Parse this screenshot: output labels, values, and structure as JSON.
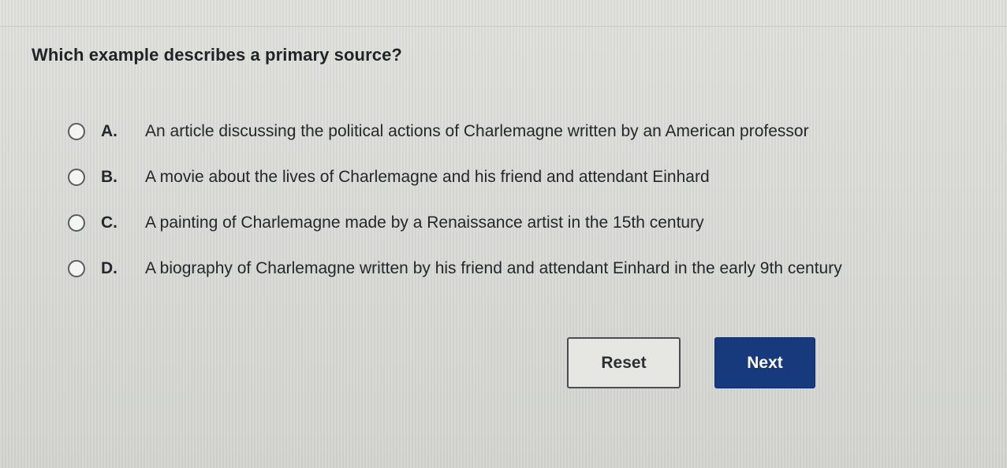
{
  "question": {
    "text": "Which example describes a primary source?"
  },
  "options": [
    {
      "letter": "A.",
      "text": "An article discussing the political actions of Charlemagne written by an American professor",
      "selected": false
    },
    {
      "letter": "B.",
      "text": "A movie about the lives of Charlemagne and his friend and attendant Einhard",
      "selected": false
    },
    {
      "letter": "C.",
      "text": "A painting of Charlemagne made by a Renaissance artist in the 15th century",
      "selected": false
    },
    {
      "letter": "D.",
      "text": "A biography of Charlemagne written by his friend and attendant Einhard in the early 9th century",
      "selected": false
    }
  ],
  "buttons": {
    "reset_label": "Reset",
    "next_label": "Next"
  },
  "colors": {
    "background": "#dcddd8",
    "next_button": "#163a7c",
    "text": "#24272b"
  }
}
